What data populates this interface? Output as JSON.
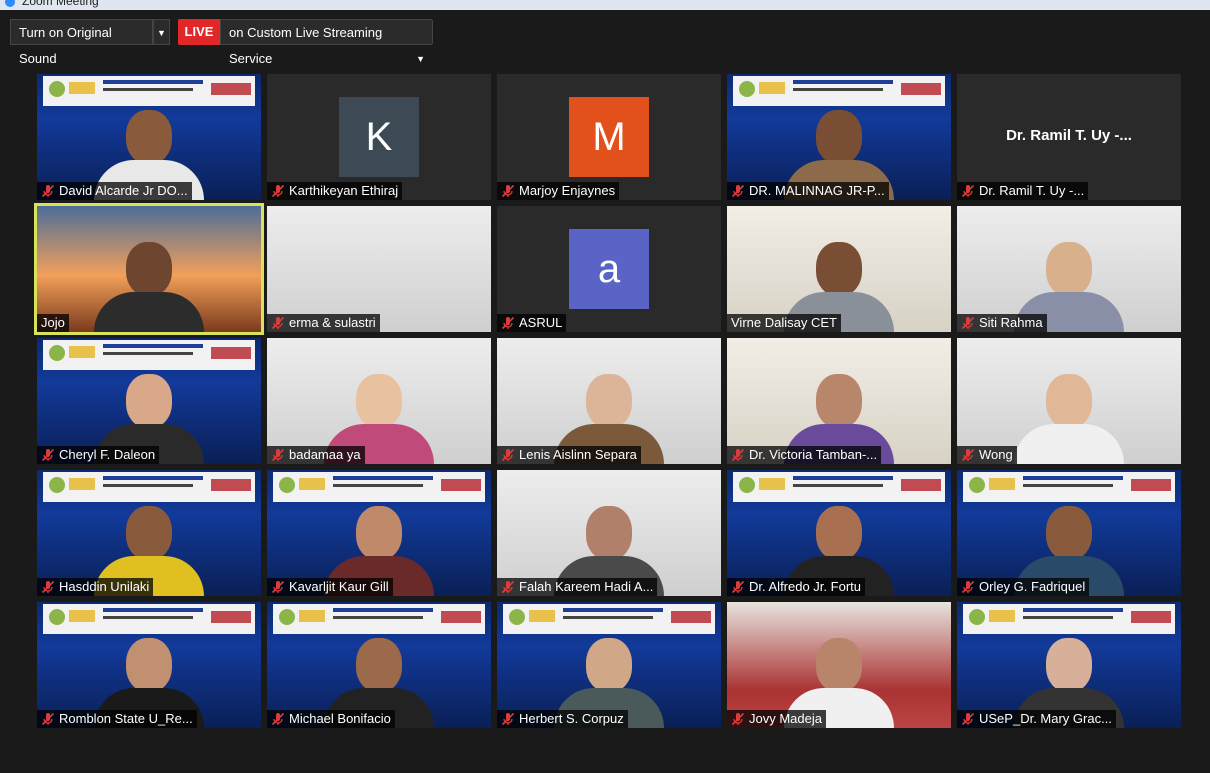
{
  "window": {
    "title": "Zoom Meeting"
  },
  "toolbar": {
    "sound_button": "Turn on Original Sound",
    "live_badge": "LIVE",
    "live_text": "on Custom Live Streaming Service"
  },
  "colors": {
    "live": "#e02828",
    "active_speaker": "#d8e35a",
    "muted_icon": "#e03a3a"
  },
  "participants": [
    {
      "name": "David Alcarde Jr DO...",
      "muted": true
    },
    {
      "name": "Karthikeyan Ethiraj",
      "muted": true,
      "avatar": "K"
    },
    {
      "name": "Marjoy Enjaynes",
      "muted": true,
      "avatar": "M"
    },
    {
      "name": "DR. MALINNAG JR-P...",
      "muted": true
    },
    {
      "name": "Dr. Ramil T. Uy -...",
      "muted": true
    },
    {
      "name": "Jojo",
      "muted": false,
      "active": true
    },
    {
      "name": "erma & sulastri",
      "muted": true
    },
    {
      "name": "ASRUL",
      "muted": true,
      "avatar": "a"
    },
    {
      "name": "Virne Dalisay CET",
      "muted": false
    },
    {
      "name": "Siti Rahma",
      "muted": true
    },
    {
      "name": "Cheryl F. Daleon",
      "muted": true
    },
    {
      "name": "badamaa ya",
      "muted": true
    },
    {
      "name": "Lenis Aislinn Separa",
      "muted": true
    },
    {
      "name": "Dr. Victoria Tamban-...",
      "muted": true
    },
    {
      "name": "Wong",
      "muted": true
    },
    {
      "name": "Hasddin Unilaki",
      "muted": true
    },
    {
      "name": "Kavarljit Kaur Gill",
      "muted": true
    },
    {
      "name": "Falah Kareem Hadi A...",
      "muted": true
    },
    {
      "name": "Dr. Alfredo Jr. Fortu",
      "muted": true
    },
    {
      "name": "Orley G. Fadriquel",
      "muted": true
    },
    {
      "name": "Romblon State U_Re...",
      "muted": true
    },
    {
      "name": "Michael Bonifacio",
      "muted": true
    },
    {
      "name": "Herbert S. Corpuz",
      "muted": true
    },
    {
      "name": "Jovy Madeja",
      "muted": true
    },
    {
      "name": "USeP_Dr. Mary Grac...",
      "muted": true
    }
  ]
}
